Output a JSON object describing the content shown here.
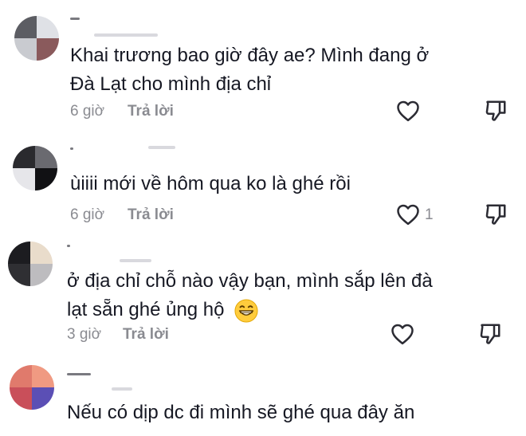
{
  "comments": [
    {
      "text_lines": [
        "Khai trương bao giờ đây ae? Mình đang ở",
        "Đà Lạt cho mình địa chỉ"
      ],
      "time": "6 giờ",
      "reply_label": "Trả lời",
      "like_count": ""
    },
    {
      "text_lines": [
        "ùiiii mới về hôm qua ko là ghé rồi"
      ],
      "time": "6 giờ",
      "reply_label": "Trả lời",
      "like_count": "1"
    },
    {
      "text_lines": [
        "ở địa chỉ chỗ nào vậy bạn, mình sắp lên đà",
        "lạt sẵn ghé ủng hộ"
      ],
      "time": "3 giờ",
      "reply_label": "Trả lời",
      "like_count": "",
      "emoji": "grinning-face-emoji"
    },
    {
      "text_lines": [
        "Nếu có dịp dc đi mình sẽ ghé qua đây ăn"
      ]
    }
  ],
  "icons": {
    "like": "heart-outline-icon",
    "dislike": "thumbs-down-icon"
  },
  "colors": {
    "text": "#161823",
    "meta": "#8a8b91",
    "icon": "#2b2b33"
  }
}
